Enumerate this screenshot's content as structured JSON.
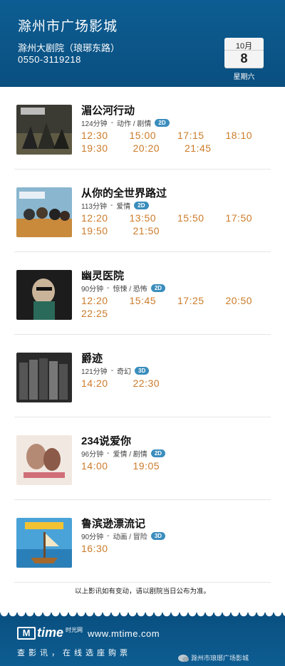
{
  "header": {
    "title": "滁州市广场影城",
    "venue": "滁州大剧院（琅琊东路）",
    "phone": "0550-3119218",
    "date": {
      "month": "10月",
      "day": "8",
      "weekday": "星期六"
    }
  },
  "colors": {
    "brand_blue": "#0d5d92",
    "time_orange": "#cc7b2a",
    "format_badge": "#3a8dbd"
  },
  "movies": [
    {
      "title": "湄公河行动",
      "duration": "124分钟",
      "genre": "动作 / 剧情",
      "format": "2D",
      "times": [
        "12:30",
        "15:00",
        "17:15",
        "18:10",
        "19:30",
        "20:20",
        "21:45"
      ]
    },
    {
      "title": "从你的全世界路过",
      "duration": "113分钟",
      "genre": "爱情",
      "format": "2D",
      "times": [
        "12:20",
        "13:50",
        "15:50",
        "17:50",
        "19:50",
        "21:50"
      ]
    },
    {
      "title": "幽灵医院",
      "duration": "90分钟",
      "genre": "惊悚 / 恐怖",
      "format": "2D",
      "times": [
        "12:20",
        "15:45",
        "17:25",
        "20:50",
        "22:25"
      ]
    },
    {
      "title": "爵迹",
      "duration": "121分钟",
      "genre": "奇幻",
      "format": "3D",
      "times": [
        "14:20",
        "22:30"
      ]
    },
    {
      "title": "234说爱你",
      "duration": "96分钟",
      "genre": "爱情 / 剧情",
      "format": "2D",
      "times": [
        "14:00",
        "19:05"
      ]
    },
    {
      "title": "鲁滨逊漂流记",
      "duration": "90分钟",
      "genre": "动画 / 冒险",
      "format": "3D",
      "times": [
        "16:30"
      ]
    }
  ],
  "notice": "以上影讯如有变动，请以剧院当日公布为准。",
  "footer": {
    "logo_mark": "M",
    "logo_word": "time",
    "logo_sub": "时光网",
    "site": "www.mtime.com",
    "slogan": "查影讯，在线选座购票",
    "wechat": "滁州市琅琊广场影城"
  }
}
